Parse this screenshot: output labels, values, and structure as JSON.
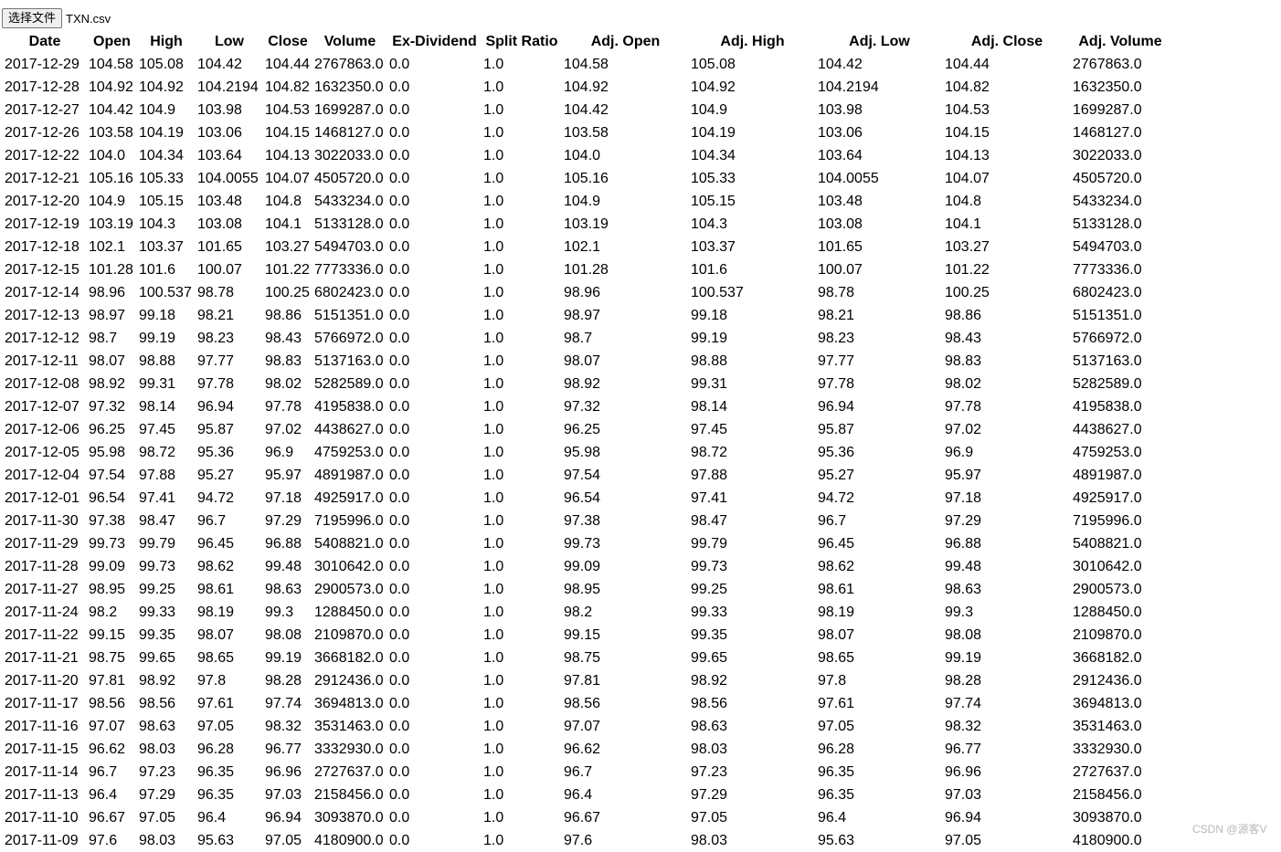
{
  "file_input": {
    "button_label": "选择文件",
    "file_name": "TXN.csv"
  },
  "table": {
    "columns": [
      "Date",
      "Open",
      "High",
      "Low",
      "Close",
      "Volume",
      "Ex-Dividend",
      "Split Ratio",
      "Adj. Open",
      "Adj. High",
      "Adj. Low",
      "Adj. Close",
      "Adj. Volume"
    ],
    "ex_dividend": "0.0",
    "split_ratio": "1.0",
    "rows": [
      [
        "2017-12-29",
        "104.58",
        "105.08",
        "104.42",
        "104.44",
        "2767863.0"
      ],
      [
        "2017-12-28",
        "104.92",
        "104.92",
        "104.2194",
        "104.82",
        "1632350.0"
      ],
      [
        "2017-12-27",
        "104.42",
        "104.9",
        "103.98",
        "104.53",
        "1699287.0"
      ],
      [
        "2017-12-26",
        "103.58",
        "104.19",
        "103.06",
        "104.15",
        "1468127.0"
      ],
      [
        "2017-12-22",
        "104.0",
        "104.34",
        "103.64",
        "104.13",
        "3022033.0"
      ],
      [
        "2017-12-21",
        "105.16",
        "105.33",
        "104.0055",
        "104.07",
        "4505720.0"
      ],
      [
        "2017-12-20",
        "104.9",
        "105.15",
        "103.48",
        "104.8",
        "5433234.0"
      ],
      [
        "2017-12-19",
        "103.19",
        "104.3",
        "103.08",
        "104.1",
        "5133128.0"
      ],
      [
        "2017-12-18",
        "102.1",
        "103.37",
        "101.65",
        "103.27",
        "5494703.0"
      ],
      [
        "2017-12-15",
        "101.28",
        "101.6",
        "100.07",
        "101.22",
        "7773336.0"
      ],
      [
        "2017-12-14",
        "98.96",
        "100.537",
        "98.78",
        "100.25",
        "6802423.0"
      ],
      [
        "2017-12-13",
        "98.97",
        "99.18",
        "98.21",
        "98.86",
        "5151351.0"
      ],
      [
        "2017-12-12",
        "98.7",
        "99.19",
        "98.23",
        "98.43",
        "5766972.0"
      ],
      [
        "2017-12-11",
        "98.07",
        "98.88",
        "97.77",
        "98.83",
        "5137163.0"
      ],
      [
        "2017-12-08",
        "98.92",
        "99.31",
        "97.78",
        "98.02",
        "5282589.0"
      ],
      [
        "2017-12-07",
        "97.32",
        "98.14",
        "96.94",
        "97.78",
        "4195838.0"
      ],
      [
        "2017-12-06",
        "96.25",
        "97.45",
        "95.87",
        "97.02",
        "4438627.0"
      ],
      [
        "2017-12-05",
        "95.98",
        "98.72",
        "95.36",
        "96.9",
        "4759253.0"
      ],
      [
        "2017-12-04",
        "97.54",
        "97.88",
        "95.27",
        "95.97",
        "4891987.0"
      ],
      [
        "2017-12-01",
        "96.54",
        "97.41",
        "94.72",
        "97.18",
        "4925917.0"
      ],
      [
        "2017-11-30",
        "97.38",
        "98.47",
        "96.7",
        "97.29",
        "7195996.0"
      ],
      [
        "2017-11-29",
        "99.73",
        "99.79",
        "96.45",
        "96.88",
        "5408821.0"
      ],
      [
        "2017-11-28",
        "99.09",
        "99.73",
        "98.62",
        "99.48",
        "3010642.0"
      ],
      [
        "2017-11-27",
        "98.95",
        "99.25",
        "98.61",
        "98.63",
        "2900573.0"
      ],
      [
        "2017-11-24",
        "98.2",
        "99.33",
        "98.19",
        "99.3",
        "1288450.0"
      ],
      [
        "2017-11-22",
        "99.15",
        "99.35",
        "98.07",
        "98.08",
        "2109870.0"
      ],
      [
        "2017-11-21",
        "98.75",
        "99.65",
        "98.65",
        "99.19",
        "3668182.0"
      ],
      [
        "2017-11-20",
        "97.81",
        "98.92",
        "97.8",
        "98.28",
        "2912436.0"
      ],
      [
        "2017-11-17",
        "98.56",
        "98.56",
        "97.61",
        "97.74",
        "3694813.0"
      ],
      [
        "2017-11-16",
        "97.07",
        "98.63",
        "97.05",
        "98.32",
        "3531463.0"
      ],
      [
        "2017-11-15",
        "96.62",
        "98.03",
        "96.28",
        "96.77",
        "3332930.0"
      ],
      [
        "2017-11-14",
        "96.7",
        "97.23",
        "96.35",
        "96.96",
        "2727637.0"
      ],
      [
        "2017-11-13",
        "96.4",
        "97.29",
        "96.35",
        "97.03",
        "2158456.0"
      ],
      [
        "2017-11-10",
        "96.67",
        "97.05",
        "96.4",
        "96.94",
        "3093870.0"
      ],
      [
        "2017-11-09",
        "97.6",
        "98.03",
        "95.63",
        "97.05",
        "4180900.0"
      ]
    ]
  },
  "watermark": "CSDN @源客V"
}
